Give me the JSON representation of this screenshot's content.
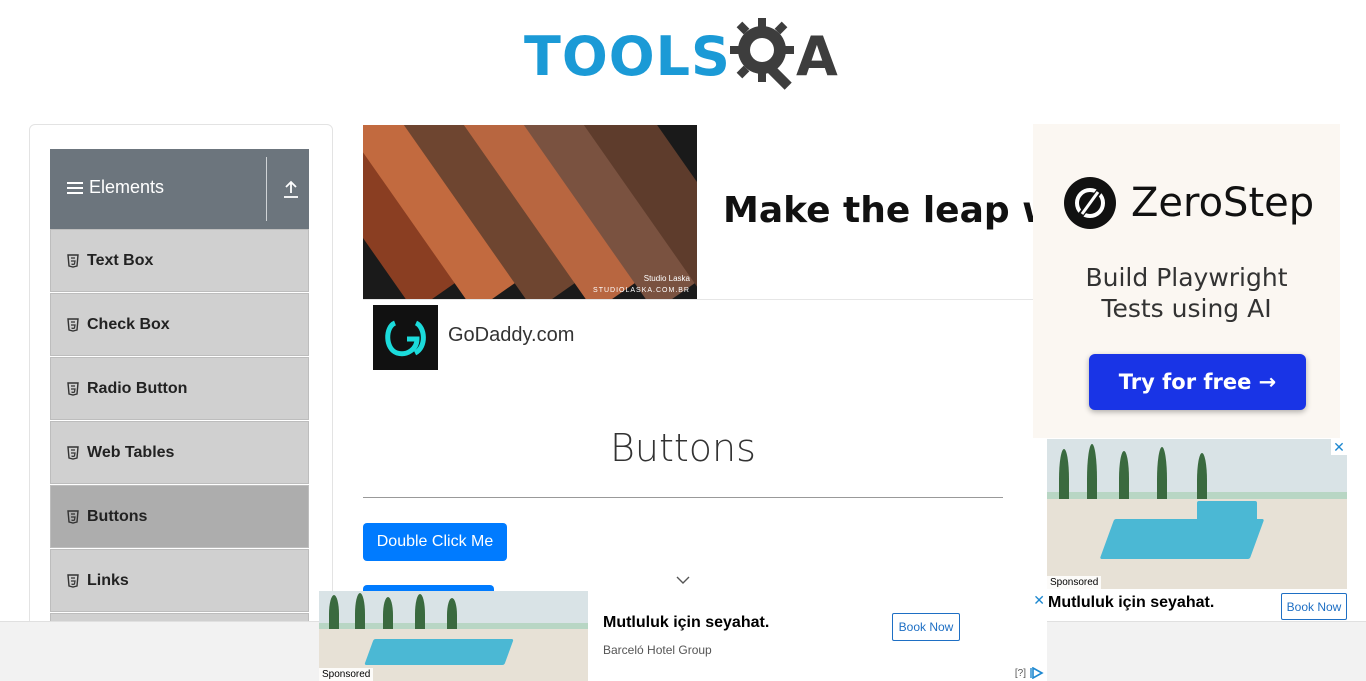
{
  "header": {
    "logo_text": "TOOLS",
    "logo_suffix": "A"
  },
  "sidebar": {
    "group_title": "Elements",
    "items": [
      {
        "label": "Text Box",
        "active": false
      },
      {
        "label": "Check Box",
        "active": false
      },
      {
        "label": "Radio Button",
        "active": false
      },
      {
        "label": "Web Tables",
        "active": false
      },
      {
        "label": "Buttons",
        "active": true
      },
      {
        "label": "Links",
        "active": false
      }
    ]
  },
  "top_ad": {
    "headline": "Make the leap with",
    "image_credit": "Studio Laska",
    "image_url_text": "STUDIOLASKA.COM.BR",
    "advertiser": "GoDaddy.com"
  },
  "main": {
    "heading": "Buttons",
    "double_click_label": "Double Click Me"
  },
  "right_ad": {
    "brand": "ZeroStep",
    "tagline_line1": "Build Playwright",
    "tagline_line2": "Tests using AI",
    "cta": "Try for free →",
    "cta_color": "#1934e6"
  },
  "hotel_ad_right": {
    "sponsored": "Sponsored",
    "tagline": "Mutluluk için seyahat.",
    "book": "Book Now",
    "close": "✕"
  },
  "bottom_ad": {
    "sponsored": "Sponsored",
    "tagline": "Mutluluk için seyahat.",
    "advertiser": "Barceló Hotel Group",
    "book": "Book Now",
    "close": "✕",
    "info": "[?]"
  },
  "colors": {
    "brand_blue": "#1b9ad6",
    "primary_button": "#007bff",
    "sidebar_header": "#6c757d",
    "menu_item": "#d0d0d0",
    "menu_item_active": "#adadad"
  }
}
